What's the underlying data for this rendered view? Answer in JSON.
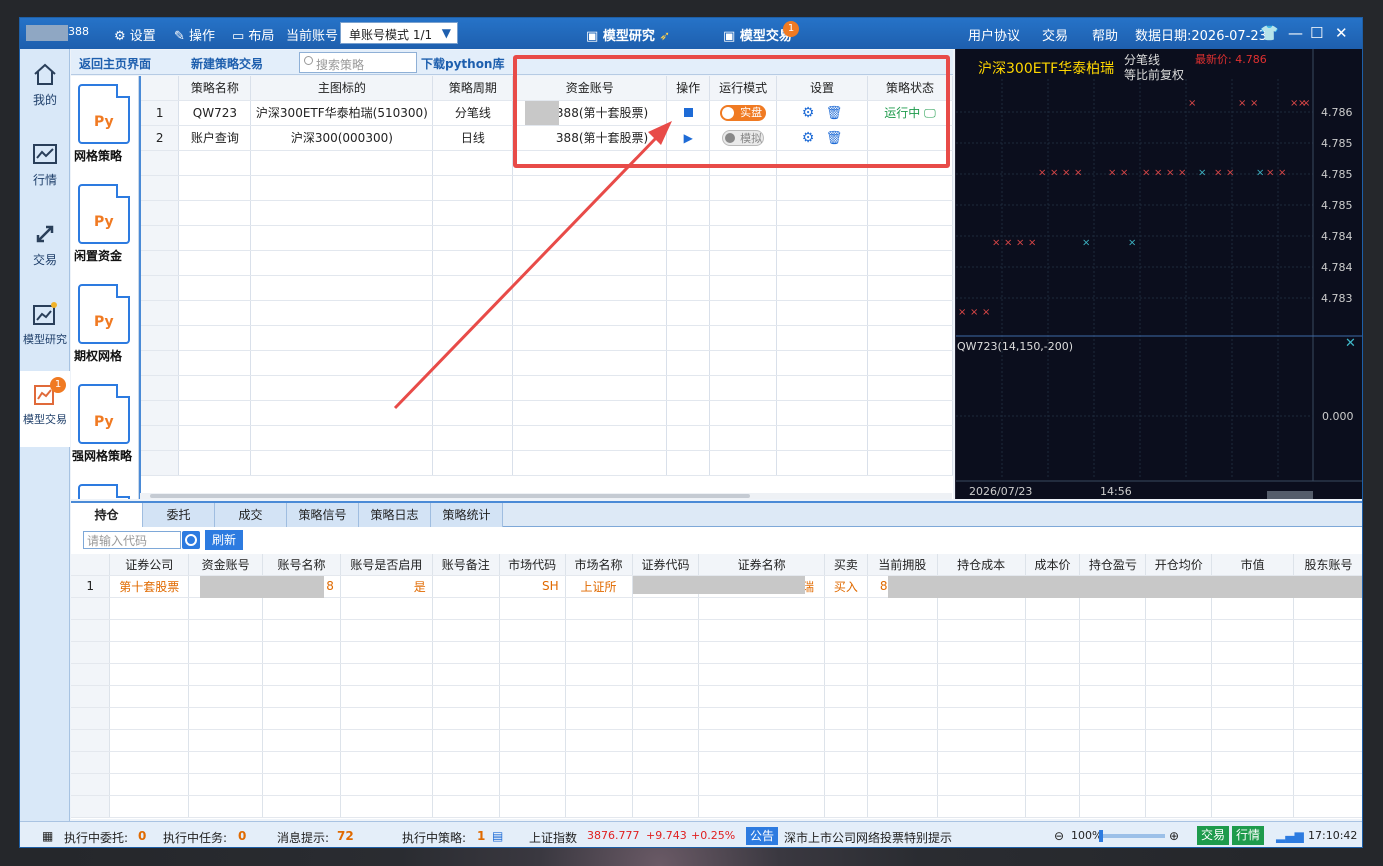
{
  "title_bar": {
    "account_suffix": "388",
    "settings": "设置",
    "operation": "操作",
    "layout": "布局",
    "current_account_label": "当前账号",
    "account_mode": "单账号模式 1/1",
    "model_research": "模型研究",
    "model_trade": "模型交易",
    "model_trade_badge": "1",
    "user_agreement": "用户协议",
    "trade": "交易",
    "help": "帮助",
    "data_date": "数据日期:2026-07-23"
  },
  "sidebar": {
    "items": [
      {
        "label": "我的",
        "icon": "home-icon"
      },
      {
        "label": "行情",
        "icon": "market-icon"
      },
      {
        "label": "交易",
        "icon": "trade-arrows-icon"
      },
      {
        "label": "模型研究",
        "icon": "model-research-icon"
      },
      {
        "label": "模型交易",
        "icon": "model-trade-icon",
        "badge": "1"
      }
    ]
  },
  "strategy_toolbar": {
    "back_home": "返回主页界面",
    "new_strategy": "新建策略交易",
    "search_placeholder": "搜索策略",
    "download_python": "下载python库"
  },
  "strategy_files": [
    {
      "name": "网格策略",
      "icon_text": "Py"
    },
    {
      "name": "闲置资金",
      "icon_text": "Py"
    },
    {
      "name": "期权网格",
      "icon_text": "Py"
    },
    {
      "name": "强网格策略",
      "icon_text": "Py"
    }
  ],
  "strategy_table": {
    "headers": [
      "策略名称",
      "主图标的",
      "策略周期",
      "资金账号",
      "操作",
      "运行模式",
      "设置",
      "策略状态"
    ],
    "rows": [
      {
        "no": "1",
        "name": "QW723",
        "symbol": "沪深300ETF华泰柏瑞(510300)",
        "period": "分笔线",
        "account": "388(第十套股票)",
        "mode": "实盘",
        "status": "运行中"
      },
      {
        "no": "2",
        "name": "账户查询",
        "symbol": "沪深300(000300)",
        "period": "日线",
        "account": "388(第十套股票)",
        "mode": "模拟",
        "status": ""
      }
    ]
  },
  "chart_data": {
    "type": "scatter",
    "title": "沪深300ETF华泰柏瑞",
    "subtitle_1": "分笔线",
    "subtitle_2": "等比前复权",
    "latest_price_label": "最新价: 4.786",
    "ytick_labels": [
      "4.786",
      "4.785",
      "4.785",
      "4.785",
      "4.784",
      "4.784",
      "4.783"
    ],
    "series": [
      {
        "color": "#e04848",
        "values": [
          4.7828,
          4.7828,
          4.7828,
          4.7838,
          4.7838,
          4.7838,
          4.7838,
          4.7848,
          4.7848,
          4.7848,
          4.7848,
          4.7848,
          4.7848,
          4.7848,
          4.7848,
          4.7848,
          4.7848,
          4.7848,
          4.7848,
          4.7848,
          4.7848,
          4.7858,
          4.7858,
          4.7858,
          4.7858,
          4.7858,
          4.7858
        ]
      },
      {
        "color": "#3fb8c8",
        "values": [
          4.7838,
          4.7838,
          4.7848,
          4.7848
        ]
      }
    ],
    "indicator_label": "QW723(14,150,-200)",
    "indicator_tick": "0.000",
    "x_labels": [
      "2026/07/23",
      "14:56"
    ],
    "grid": true
  },
  "bottom_tabs": [
    "持仓",
    "委托",
    "成交",
    "策略信号",
    "策略日志",
    "策略统计"
  ],
  "code_input_placeholder": "请输入代码",
  "refresh": "刷新",
  "positions_table": {
    "headers": [
      "证券公司",
      "资金账号",
      "账号名称",
      "账号是否启用",
      "账号备注",
      "市场代码",
      "市场名称",
      "证券代码",
      "证券名称",
      "买卖",
      "当前拥股",
      "持仓成本",
      "成本价",
      "持仓盈亏",
      "开仓均价",
      "市值",
      "股东账号"
    ],
    "rows": [
      {
        "no": "1",
        "broker": "第十套股票",
        "account_tail": "8",
        "enabled": "是",
        "market_code": "SH",
        "market_name": "上证所",
        "sec_name_tail": "瑞",
        "side": "买入",
        "holding": "8"
      }
    ]
  },
  "status_bar": {
    "exec_orders_label": "执行中委托:",
    "exec_orders": "0",
    "exec_tasks_label": "执行中任务:",
    "exec_tasks": "0",
    "messages_label": "消息提示:",
    "messages": "72",
    "exec_strategies_label": "执行中策略:",
    "exec_strategies": "1",
    "index_name": "上证指数",
    "index_value": "3876.777",
    "index_change": "+9.743",
    "index_pct": "+0.25%",
    "notice_label": "公告",
    "notice_text": "深市上市公司网络投票特别提示",
    "zoom": "100%",
    "trade_btn": "交易",
    "quote_btn": "行情",
    "time": "17:10:42"
  }
}
